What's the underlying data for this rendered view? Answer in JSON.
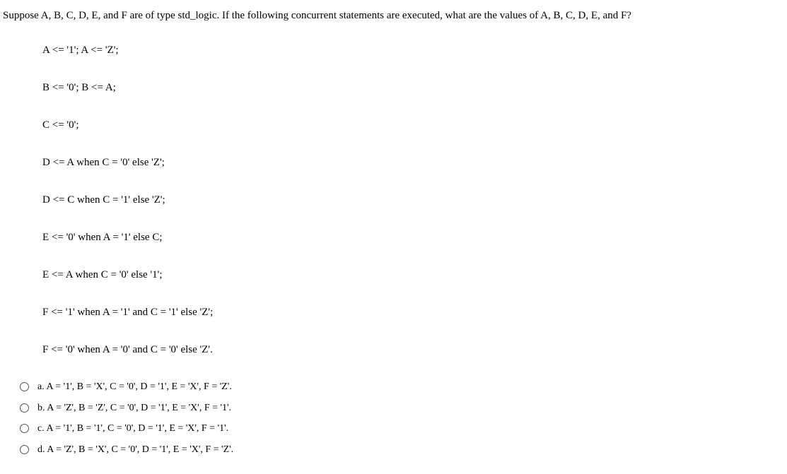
{
  "question": "Suppose A, B, C, D, E, and F are of type std_logic. If the following concurrent statements are executed, what are the values of A, B, C, D, E, and F?",
  "code_lines": [
    "A <= '1'; A <= 'Z';",
    "B <= '0'; B <= A;",
    "C <= '0';",
    "D <= A when C = '0' else 'Z';",
    "D <= C when C = '1' else 'Z';",
    "E <= '0' when A = '1' else C;",
    "E <= A when C = '0' else '1';",
    "F <= '1' when A = '1' and C = '1' else 'Z';",
    "F <= '0' when A = '0' and C = '0' else 'Z'."
  ],
  "options": [
    {
      "label": "a. A = '1', B = 'X', C = '0', D = '1', E = 'X', F = 'Z'."
    },
    {
      "label": "b. A = 'Z', B = 'Z', C = '0', D = '1', E = 'X', F = '1'."
    },
    {
      "label": "c. A = '1', B = '1', C = '0', D = '1', E = 'X', F = '1'."
    },
    {
      "label": "d. A = 'Z', B = 'X', C = '0', D = '1', E = 'X', F = 'Z'."
    }
  ]
}
